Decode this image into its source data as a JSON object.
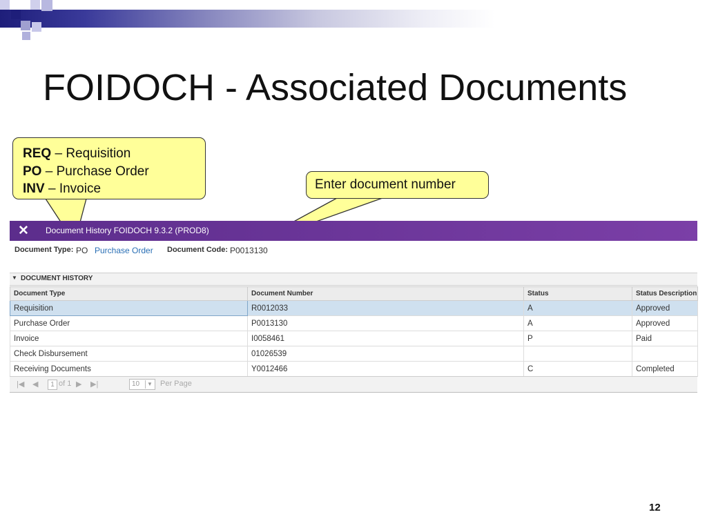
{
  "slide": {
    "title": "FOIDOCH - Associated Documents",
    "page_number": "12"
  },
  "callouts": {
    "codes": [
      {
        "code": "REQ",
        "sep": " – ",
        "meaning": "Requisition"
      },
      {
        "code": "PO",
        "sep": " – ",
        "meaning": "Purchase Order"
      },
      {
        "code": "INV",
        "sep": " – ",
        "meaning": "Invoice"
      }
    ],
    "enter": "Enter document number"
  },
  "app": {
    "close_glyph": "✕",
    "title": "Document History FOIDOCH 9.3.2 (PROD8)",
    "keyblock": {
      "doc_type_label": "Document Type:",
      "doc_type_value": "PO",
      "doc_type_desc": "Purchase Order",
      "doc_code_label": "Document Code:",
      "doc_code_value": "P0013130"
    },
    "section": {
      "toggle_glyph": "▼",
      "title": "DOCUMENT HISTORY"
    },
    "table": {
      "columns": [
        "Document Type",
        "Document Number",
        "Status",
        "Status Description"
      ],
      "rows": [
        [
          "Requisition",
          "R0012033",
          "A",
          "Approved"
        ],
        [
          "Purchase Order",
          "P0013130",
          "A",
          "Approved"
        ],
        [
          "Invoice",
          "I0058461",
          "P",
          "Paid"
        ],
        [
          "Check Disbursement",
          "01026539",
          "",
          ""
        ],
        [
          "Receiving Documents",
          "Y0012466",
          "C",
          "Completed"
        ]
      ]
    },
    "pager": {
      "first_glyph": "|◀",
      "prev_glyph": "◀",
      "page": "1",
      "of_text": "of 1",
      "next_glyph": "▶",
      "last_glyph": "▶|",
      "per_page_value": "10",
      "per_page_caret": "▼",
      "per_page_label": "Per Page"
    }
  },
  "colors": {
    "header_purple": "#6b3399",
    "callout_fill": "#ffff99",
    "selected_row": "#cfe0ef",
    "link_blue": "#2a6fb5"
  }
}
